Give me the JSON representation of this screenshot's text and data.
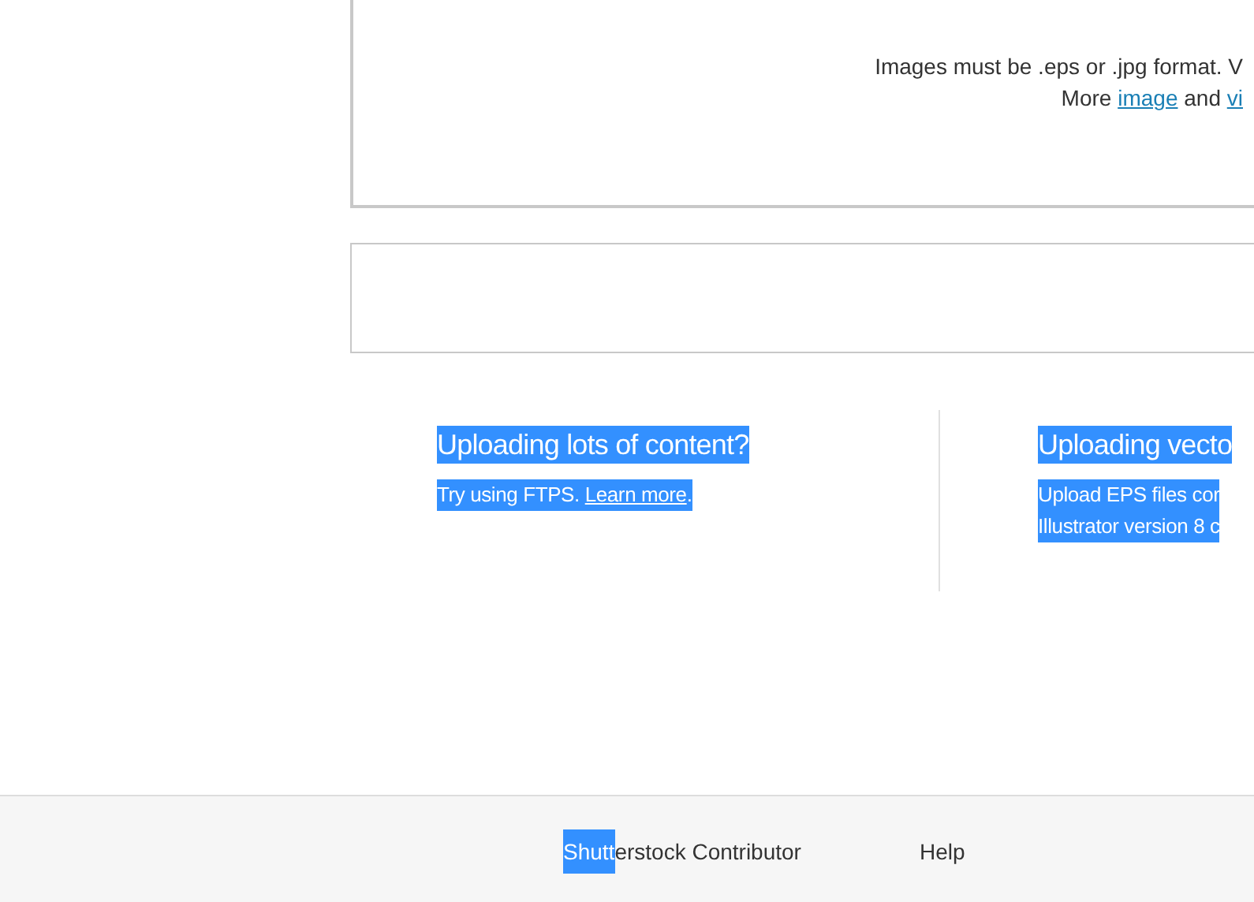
{
  "upload_box": {
    "lines": [
      {
        "parts": [
          {
            "text": "Images must be .eps or .jpg format. V",
            "link": false
          }
        ]
      },
      {
        "parts": [
          {
            "text": "More ",
            "link": false
          },
          {
            "text": "image",
            "link": true
          },
          {
            "text": " and ",
            "link": false
          },
          {
            "text": "vi",
            "link": true
          }
        ]
      }
    ]
  },
  "tips": [
    {
      "title": "Uploading lots of content?",
      "highlighted": true,
      "lines": [
        {
          "kind": "text",
          "text": "Try using FTPS. "
        },
        {
          "kind": "link",
          "text": "Learn more"
        },
        {
          "kind": "text",
          "text": "."
        }
      ]
    },
    {
      "title": "Uploading vecto",
      "highlighted": true,
      "lines": [
        {
          "kind": "text",
          "text": "Upload EPS files cor"
        },
        {
          "kind": "break",
          "text": "Illustrator version 8 c"
        }
      ]
    }
  ],
  "footer": {
    "items": [
      {
        "selected_text": "Shutt",
        "text": "erstock Contributor"
      },
      {
        "text": "Help"
      }
    ]
  }
}
